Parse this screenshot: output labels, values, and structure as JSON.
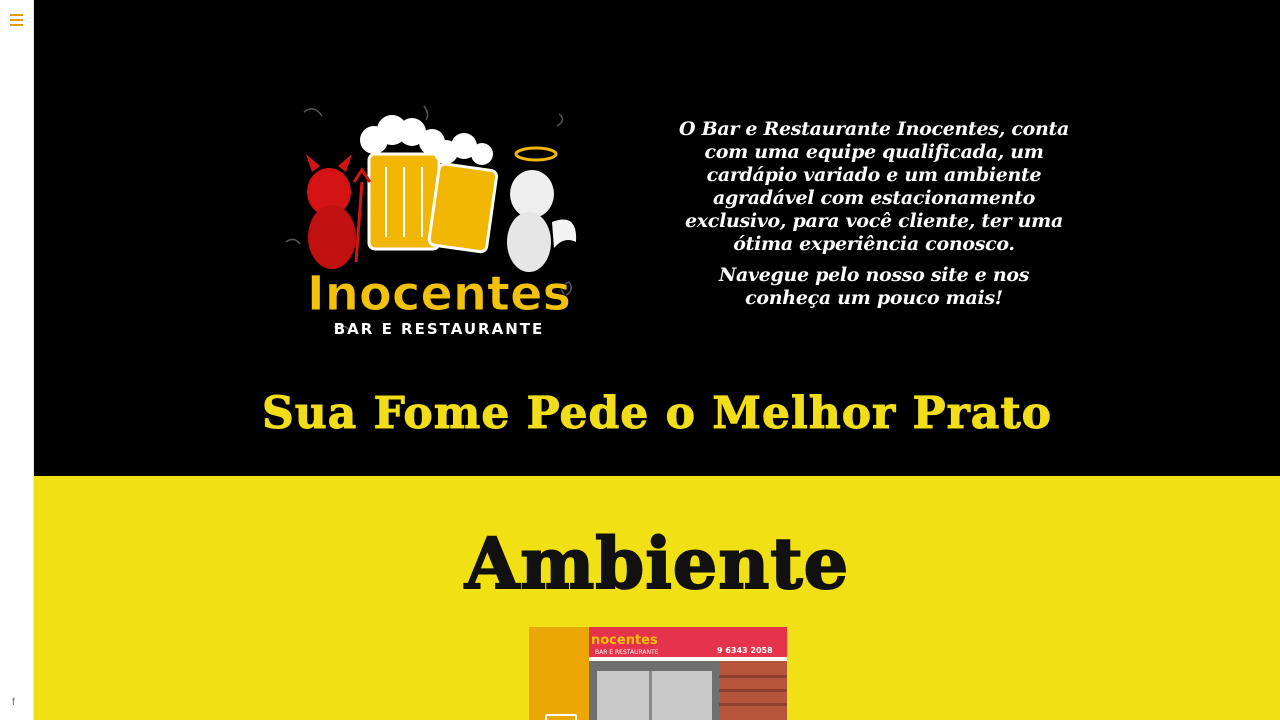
{
  "sidebar": {
    "menu_icon": "hamburger-icon",
    "social_icon": "f"
  },
  "hero": {
    "logo": {
      "title": "Inocentes",
      "subtitle": "BAR E RESTAURANTE"
    },
    "intro_p1": "O Bar e Restaurante Inocentes, conta com uma equipe qualificada, um cardápio variado e um ambiente agradável com estacionamento exclusivo, para você cliente, ter uma ótima experiência conosco.",
    "intro_p2": "Navegue pelo nosso site e nos conheça um pouco mais!",
    "tagline": "Sua Fome Pede o Melhor Prato"
  },
  "ambiente": {
    "title": "Ambiente",
    "photo": {
      "sign_name": "nocentes",
      "sign_sub": "BAR E RESTAURANTE",
      "sign_phone": "9 6343 2058"
    }
  },
  "colors": {
    "accent": "#e69a0a",
    "yellow": "#f1e013",
    "tagline": "#f2de18",
    "black": "#000000"
  }
}
